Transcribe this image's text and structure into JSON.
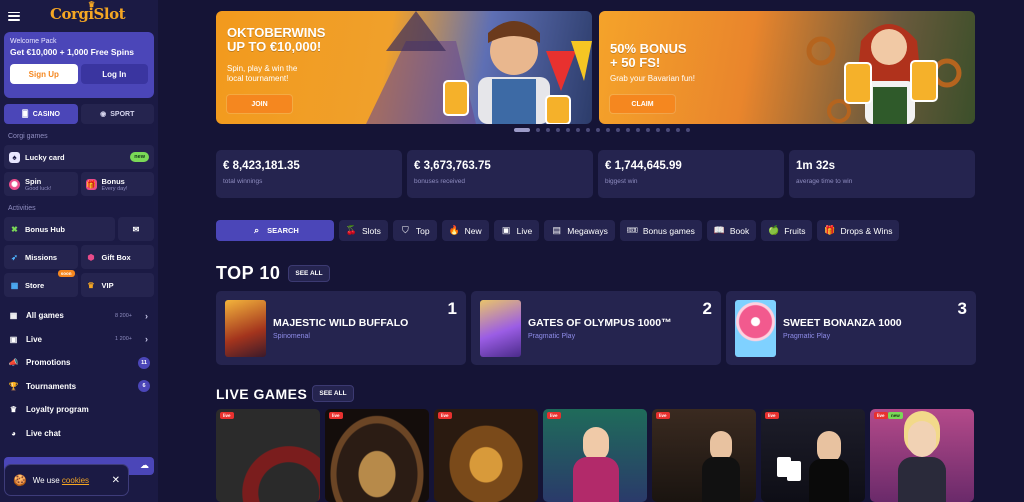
{
  "brand": {
    "logo_text": "CorgiSlot"
  },
  "welcome": {
    "title": "Welcome Pack",
    "offer": "Get €10,000 + 1,000 Free Spins",
    "signup_label": "Sign Up",
    "login_label": "Log In"
  },
  "modes": {
    "casino": "CASINO",
    "sport": "SPORT"
  },
  "corgi_games": {
    "heading": "Corgi games",
    "lucky_card": "Lucky card",
    "lucky_badge": "new",
    "spin": "Spin",
    "spin_sub": "Good luck!",
    "bonus": "Bonus",
    "bonus_sub": "Every day!"
  },
  "activities": {
    "heading": "Activities",
    "bonus_hub": "Bonus Hub",
    "missions": "Missions",
    "gift_box": "Gift Box",
    "store": "Store",
    "store_badge": "soon",
    "vip": "VIP"
  },
  "nav": {
    "all_games": "All games",
    "all_games_count": "8 200+",
    "live": "Live",
    "live_count": "1 200+",
    "promotions": "Promotions",
    "promotions_count": "11",
    "tournaments": "Tournaments",
    "tournaments_count": "6",
    "loyalty": "Loyalty program",
    "live_chat": "Live chat"
  },
  "cookie": {
    "text": "We use",
    "link": "cookies"
  },
  "banners": [
    {
      "title_1": "OKTOBERWINS",
      "title_2": "UP TO €10,000!",
      "sub_1": "Spin, play & win the",
      "sub_2": "local tournament!",
      "button": "JOIN"
    },
    {
      "title_1": "50% BONUS",
      "title_2": "+ 50 FS!",
      "sub_1": "Grab your Bavarian fun!",
      "sub_2": "",
      "button": "CLAIM"
    }
  ],
  "stats": [
    {
      "value": "€ 8,423,181.35",
      "label": "total winnings"
    },
    {
      "value": "€ 3,673,763.75",
      "label": "bonuses received"
    },
    {
      "value": "€ 1,744,645.99",
      "label": "biggest win"
    },
    {
      "value": "1m 32s",
      "label": "average time to win"
    }
  ],
  "filters": {
    "search": "SEARCH",
    "slots": "Slots",
    "top": "Top",
    "new": "New",
    "live": "Live",
    "megaways": "Megaways",
    "bonus_games": "Bonus games",
    "book": "Book",
    "fruits": "Fruits",
    "drops": "Drops & Wins"
  },
  "top10": {
    "title": "TOP 10",
    "see_all": "SEE ALL",
    "items": [
      {
        "rank": "1",
        "name": "MAJESTIC WILD BUFFALO",
        "provider": "Spinomenal"
      },
      {
        "rank": "2",
        "name": "GATES OF OLYMPUS 1000™",
        "provider": "Pragmatic Play"
      },
      {
        "rank": "3",
        "name": "SWEET BONANZA 1000",
        "provider": "Pragmatic Play"
      }
    ]
  },
  "live_games": {
    "title": "LIVE GAMES",
    "see_all": "SEE ALL",
    "tag": "live"
  },
  "colors": {
    "accent": "#4b46b8",
    "orange": "#f5871f",
    "panel": "#25244f",
    "bg": "#151436"
  }
}
